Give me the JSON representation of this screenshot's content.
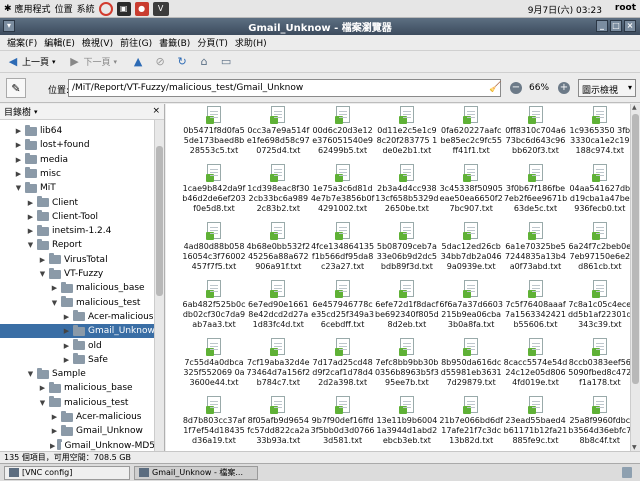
{
  "topbar": {
    "menus": [
      {
        "icon": "star-icon",
        "label": "應用程式"
      },
      {
        "icon": "",
        "label": "位置"
      },
      {
        "icon": "",
        "label": "系統"
      }
    ],
    "clock": "9月7日(六) 03:23",
    "user": "root"
  },
  "window": {
    "title": "Gmail_Unknow - 檔案瀏覽器"
  },
  "menubar": [
    "檔案(F)",
    "編輯(E)",
    "檢視(V)",
    "前往(G)",
    "書籤(B)",
    "分頁(T)",
    "求助(H)"
  ],
  "toolbar": {
    "back": "上一頁",
    "forward": "下一頁"
  },
  "location": {
    "label": "位置:",
    "path": "/MiT/Report/VT-Fuzzy/malicious_test/Gmail_Unknow",
    "zoom": "66%",
    "view": "圖示檢視"
  },
  "sidebar": {
    "title": "目錄樹",
    "items": [
      {
        "label": "lib64",
        "expander": "▶",
        "level": 0
      },
      {
        "label": "lost+found",
        "expander": "▶",
        "level": 0
      },
      {
        "label": "media",
        "expander": "▶",
        "level": 0
      },
      {
        "label": "misc",
        "expander": "▶",
        "level": 0
      },
      {
        "label": "MiT",
        "expander": "▼",
        "level": 0
      },
      {
        "label": "Client",
        "expander": "▶",
        "level": 1
      },
      {
        "label": "Client-Tool",
        "expander": "▶",
        "level": 1
      },
      {
        "label": "inetsim-1.2.4",
        "expander": "▶",
        "level": 1
      },
      {
        "label": "Report",
        "expander": "▼",
        "level": 1
      },
      {
        "label": "VirusTotal",
        "expander": "▶",
        "level": 2
      },
      {
        "label": "VT-Fuzzy",
        "expander": "▼",
        "level": 2
      },
      {
        "label": "malicious_base",
        "expander": "▶",
        "level": 3
      },
      {
        "label": "malicious_test",
        "expander": "▼",
        "level": 3
      },
      {
        "label": "Acer-malicious",
        "expander": "▶",
        "level": 4
      },
      {
        "label": "Gmail_Unknow",
        "expander": "▶",
        "level": 4,
        "selected": true
      },
      {
        "label": "old",
        "expander": "▶",
        "level": 4
      },
      {
        "label": "Safe",
        "expander": "▶",
        "level": 4
      },
      {
        "label": "Sample",
        "expander": "▼",
        "level": 1
      },
      {
        "label": "malicious_base",
        "expander": "▶",
        "level": 2
      },
      {
        "label": "malicious_test",
        "expander": "▼",
        "level": 2
      },
      {
        "label": "Acer-malicious",
        "expander": "▶",
        "level": 3
      },
      {
        "label": "Gmail_Unknow",
        "expander": "▶",
        "level": 3
      },
      {
        "label": "Gmail_Unknow-MD5",
        "expander": "▶",
        "level": 3
      }
    ]
  },
  "files": [
    "0b5471f8d0fa55de173baed8b28553c5.txt",
    "0cc3a7e9a514fe1fe698d58c970725d4.txt",
    "00d6c20d3e12e376051540e962499b5.txt",
    "0d11e2c5e1c98c20f283775 1de0e2b1.txt",
    "0fa620227aafcbe85ec2c9fc55ff41f1.txt",
    "0ff8310c704a673bc6d643c96bb620f3.txt",
    "1c9365350 3fb3330ca1e2c19188c974.txt",
    "1cae9b842da9fb46d2de6ef203f0e5d8.txt",
    "1cd398eac8f302cb33bc6a9892c83b2.txt",
    "1e75a3c6d81d4e7b7e3856b0f4291002.txt",
    "2b3a4d4cc93813cf658b5329d2650be.txt",
    "3c45338f50905eae50ea6650f27bc907.txt",
    "3f0b67f186fbe7eb2f6ee9671b63de5c.txt",
    "04aa541627dbd19cba1a47be936fecb0.txt",
    "4ad80d88b05816054c3f76002457f7f5.txt",
    "4b68e0bb532f245256a88a672906a91f.txt",
    "4fce134864135f1b566df95da8c23a27.txt",
    "5b08709ceb7a33e06b9d2dc5bdb89f3d.txt",
    "5dac12ed26cb34bb7db2a0469a0939e.txt",
    "6a1e70325be57244835a13b4a0f73abd.txt",
    "6a24f7c2beb0e7eb97150e6e2d861cb.txt",
    "6ab482f525b0cdb02cf30c7da9ab7aa3.txt",
    "6e7ed90e16618e42dcd2d27a1d83fc4d.txt",
    "6e457946778ce35cd25f349a36cebdff.txt",
    "6efe72d1f8dacfbe692340f805d8d2eb.txt",
    "6f6a7a37d6603215b9ea06cba3b0a8fa.txt",
    "7c5f76408aaaf7a1563342421b55606.txt",
    "7c8a1c05c4ecedd5b1af22301d343c39.txt",
    "7c55d4a0dbca325f552069 0a3600e44.txt",
    "7cf19aba32d4e73464d7a156f2b784c7.txt",
    "7d17ad25cd48d9f2caf1d78d42d2a398.txt",
    "7efc8bb9bb30b0356b8963b5f395ee7b.txt",
    "8b950da616dcd55981eb36317d29879.txt",
    "8cacc5574e54d24c12e05d8064fd019e.txt",
    "8ccb0383eef565090fbed8c472f1a178.txt",
    "8d7b803cc37af1f7ef54d18435d36a19.txt",
    "8f05afb9d9654fc57dd822ca2a33b93a.txt",
    "9b7f90def16ffd3f5bb0d3d07663d581.txt",
    "13e11b9b60041a3944d1abd2ebcb3eb.txt",
    "21b7e066bd6df17afe21f7c3dc13b82d.txt",
    "23ead55baed4b61171b12fa21885fe9c.txt",
    "25a8f9960fdbcb3564d36ebfc78b8c4f.txt"
  ],
  "status": "135 個項目，可用空間：708.5 GB",
  "taskbar": [
    "[VNC config]",
    "Gmail_Unknow - 檔案..."
  ]
}
